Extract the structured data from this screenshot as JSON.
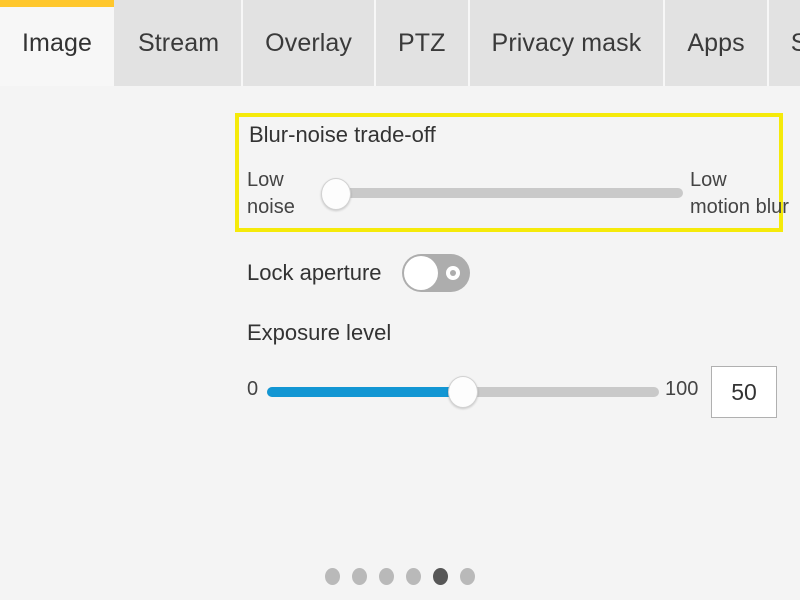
{
  "theme": {
    "accent_yellow": "#ffc72c",
    "highlight_yellow": "#f5ea0a",
    "slider_blue": "#1296d3",
    "tab_inactive_bg": "#e2e2e2",
    "tab_active_bg": "#f7f7f7",
    "page_bg": "#f4f4f4",
    "toggle_track": "#adadad",
    "dot_inactive": "#b9b9b9",
    "dot_active": "#575757"
  },
  "tabs": [
    {
      "label": "Image",
      "active": true
    },
    {
      "label": "Stream",
      "active": false
    },
    {
      "label": "Overlay",
      "active": false
    },
    {
      "label": "PTZ",
      "active": false
    },
    {
      "label": "Privacy mask",
      "active": false
    },
    {
      "label": "Apps",
      "active": false
    },
    {
      "label": "System",
      "active": false
    }
  ],
  "settings": {
    "blur_noise": {
      "title": "Blur-noise trade-off",
      "left_label_line1": "Low",
      "left_label_line2": "noise",
      "right_label_line1": "Low",
      "right_label_line2": "motion blur",
      "value_percent": 0,
      "highlighted": true
    },
    "lock_aperture": {
      "label": "Lock aperture",
      "state": "off"
    },
    "exposure_level": {
      "title": "Exposure level",
      "min_label": "0",
      "max_label": "100",
      "value": "50",
      "value_percent": 50
    }
  },
  "pagination": {
    "total": 6,
    "active_index": 5,
    "dots": [
      "1",
      "2",
      "3",
      "4",
      "5",
      "6"
    ]
  }
}
